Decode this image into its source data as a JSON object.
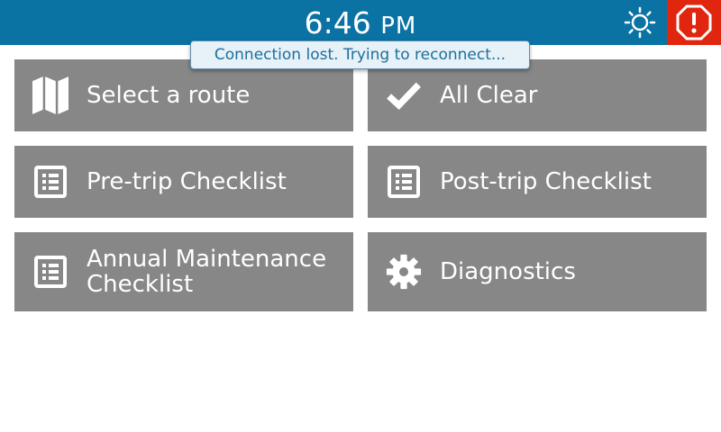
{
  "header": {
    "time": "6:46",
    "ampm": "PM",
    "brightness_icon": "sun-icon",
    "alert_icon": "stop-alert-icon"
  },
  "toast": {
    "message": "Connection lost. Trying to reconnect..."
  },
  "menu": {
    "items": [
      {
        "label": "Select a route",
        "icon": "map-icon"
      },
      {
        "label": "All Clear",
        "icon": "checkmark-icon"
      },
      {
        "label": "Pre-trip Checklist",
        "icon": "checklist-icon"
      },
      {
        "label": "Post-trip Checklist",
        "icon": "checklist-icon"
      },
      {
        "label": "Annual Maintenance Checklist",
        "icon": "checklist-icon"
      },
      {
        "label": "Diagnostics",
        "icon": "gear-icon"
      }
    ]
  },
  "colors": {
    "header_bg": "#0a73a4",
    "alert_bg": "#e0260f",
    "tile_bg": "#878787",
    "toast_text": "#1d6f9c"
  }
}
